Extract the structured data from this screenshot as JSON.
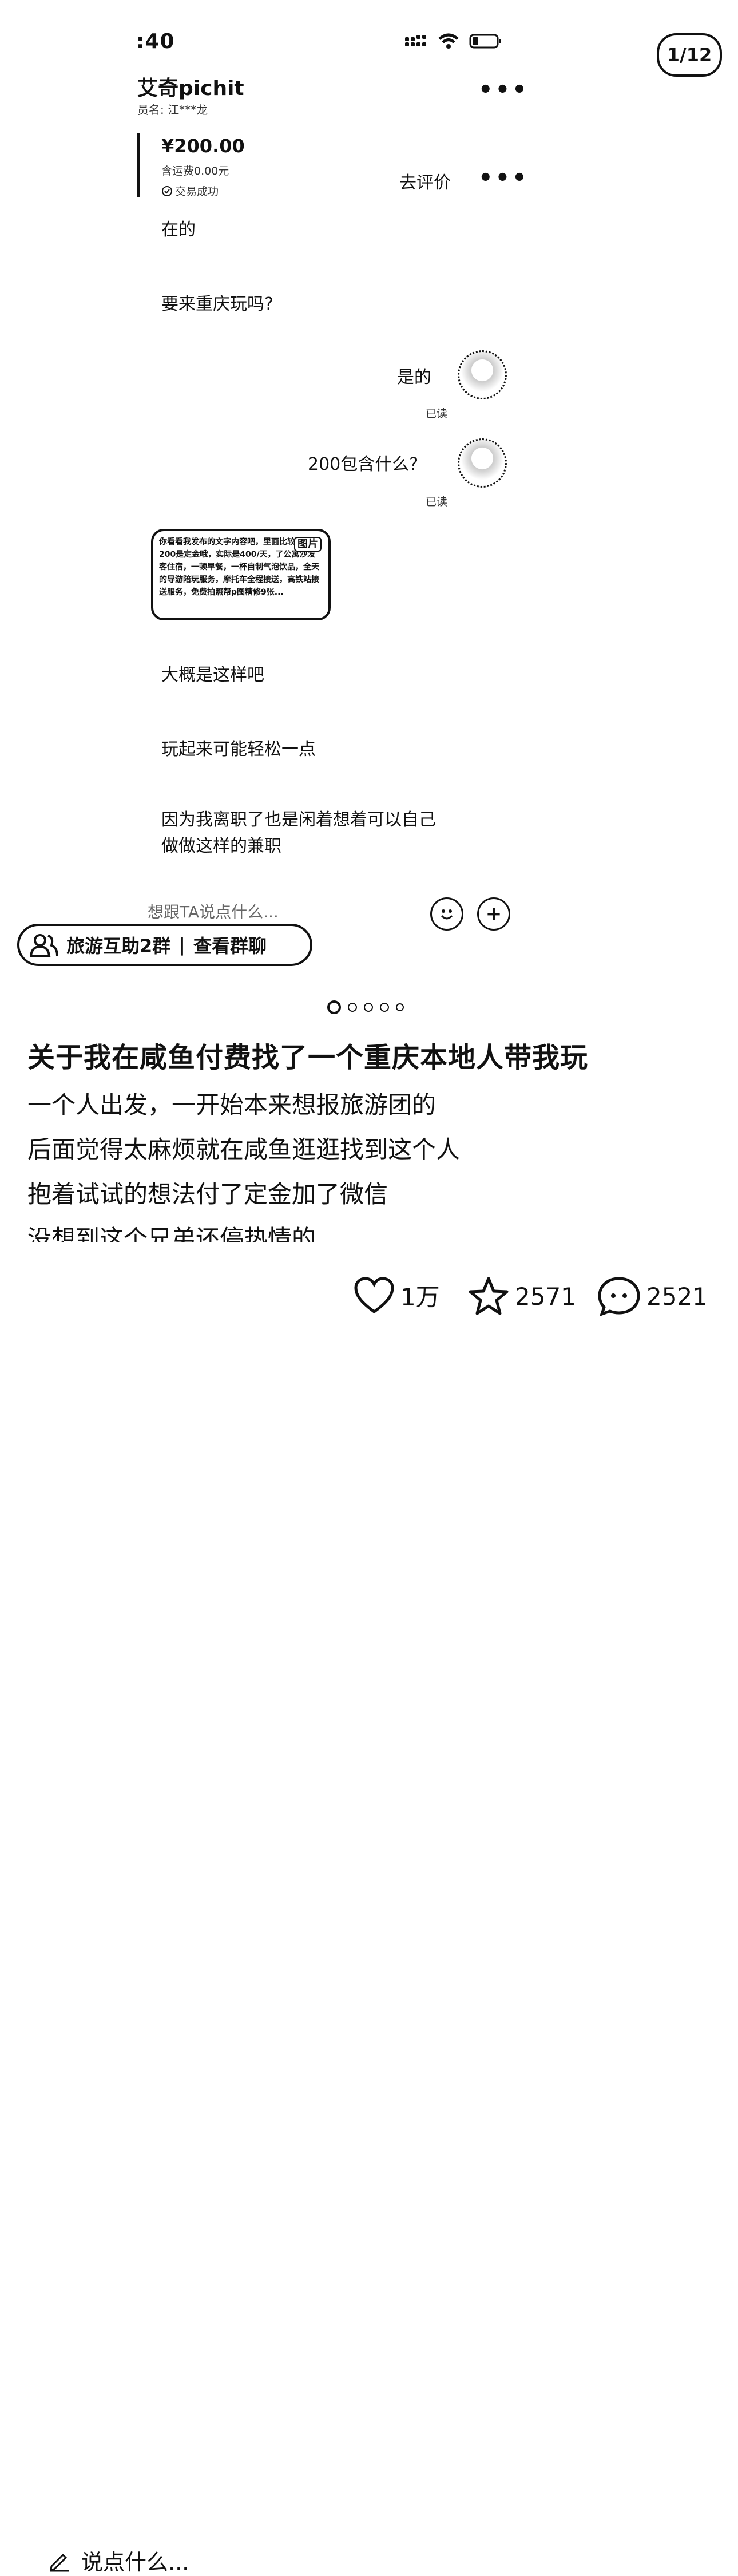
{
  "status_bar": {
    "time": ":40"
  },
  "page_counter": "1/12",
  "chat": {
    "seller_name": "艾奇pichit",
    "seller_sub": "员名: 江***龙",
    "order": {
      "price": "¥200.00",
      "freight": "含运费0.00元",
      "status": "交易成功",
      "review_label": "去评价"
    },
    "messages": [
      {
        "side": "left",
        "text": "在的"
      },
      {
        "side": "left",
        "text": "要来重庆玩吗?"
      },
      {
        "side": "right",
        "text": "是的",
        "read": "已读"
      },
      {
        "side": "right",
        "text": "200包含什么?",
        "read": "已读"
      },
      {
        "side": "left",
        "type": "image",
        "tag": "图片",
        "text": "你看看我发布的文字内容吧，里面比较详细。200是定金哦，实际是400/天，了公寓沙发客住宿，一顿早餐，一杯自制气泡饮品，全天的导游陪玩服务，摩托车全程接送，高铁站接送服务，免费拍照帮p图精修9张..."
      },
      {
        "side": "left",
        "text": "大概是这样吧"
      },
      {
        "side": "left",
        "text": "玩起来可能轻松一点"
      },
      {
        "side": "left",
        "text": "因为我离职了也是闲着想着可以自己做做这样的兼职"
      }
    ],
    "composer_placeholder": "想跟TA说点什么..."
  },
  "group_pill": {
    "label": "旅游互助2群",
    "separator": "|",
    "action": "查看群聊"
  },
  "carousel": {
    "count": 5,
    "active": 0
  },
  "post": {
    "title": "关于我在咸鱼付费找了一个重庆本地人带我玩",
    "lines": [
      "一个人出发，一开始本来想报旅游团的",
      "后面觉得太麻烦就在咸鱼逛逛找到这个人",
      "抱着试试的想法付了定金加了微信",
      "没想到这个兄弟还停热情的"
    ]
  },
  "bottom_bar": {
    "comment_placeholder": "说点什么...",
    "likes": "1万",
    "favorites": "2571",
    "comments": "2521"
  }
}
